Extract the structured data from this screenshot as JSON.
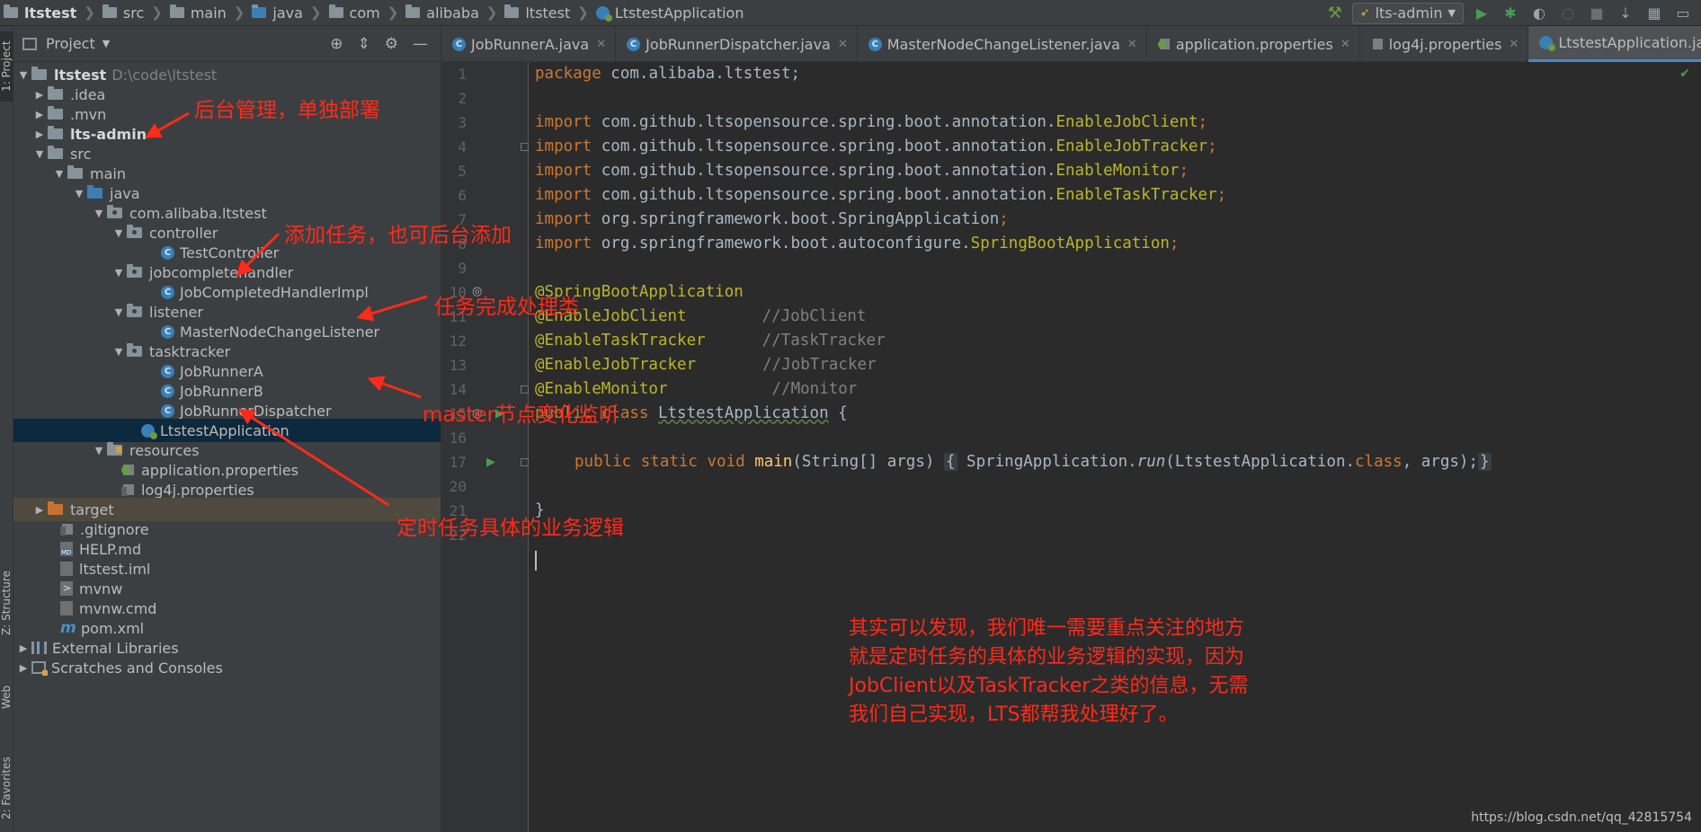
{
  "navbar": {
    "crumbs": [
      "ltstest",
      "src",
      "main",
      "java",
      "com",
      "alibaba",
      "ltstest",
      "LtstestApplication"
    ],
    "run_config": "lts-admin"
  },
  "left_stripe": {
    "project_tab": "1: Project",
    "structure_tab": "Z: Structure",
    "web_tab": "Web",
    "favorites_tab": "2: Favorites"
  },
  "project_panel": {
    "title": "Project",
    "tree": [
      {
        "label": "ltstest",
        "path": "D:\\code\\ltstest"
      },
      {
        "label": ".idea"
      },
      {
        "label": ".mvn"
      },
      {
        "label": "lts-admin"
      },
      {
        "label": "src"
      },
      {
        "label": "main"
      },
      {
        "label": "java"
      },
      {
        "label": "com.alibaba.ltstest"
      },
      {
        "label": "controller"
      },
      {
        "label": "TestController"
      },
      {
        "label": "jobcompletehandler"
      },
      {
        "label": "JobCompletedHandlerImpl"
      },
      {
        "label": "listener"
      },
      {
        "label": "MasterNodeChangeListener"
      },
      {
        "label": "tasktracker"
      },
      {
        "label": "JobRunnerA"
      },
      {
        "label": "JobRunnerB"
      },
      {
        "label": "JobRunnerDispatcher"
      },
      {
        "label": "LtstestApplication"
      },
      {
        "label": "resources"
      },
      {
        "label": "application.properties"
      },
      {
        "label": "log4j.properties"
      },
      {
        "label": "target"
      },
      {
        "label": ".gitignore"
      },
      {
        "label": "HELP.md"
      },
      {
        "label": "ltstest.iml"
      },
      {
        "label": "mvnw"
      },
      {
        "label": "mvnw.cmd"
      },
      {
        "label": "pom.xml"
      },
      {
        "label": "External Libraries"
      },
      {
        "label": "Scratches and Consoles"
      }
    ]
  },
  "editor": {
    "tabs": [
      {
        "label": "JobRunnerA.java"
      },
      {
        "label": "JobRunnerDispatcher.java"
      },
      {
        "label": "MasterNodeChangeListener.java"
      },
      {
        "label": "application.properties"
      },
      {
        "label": "log4j.properties"
      },
      {
        "label": "LtstestApplication.java"
      }
    ],
    "line_numbers": [
      "1",
      "2",
      "3",
      "4",
      "5",
      "6",
      "7",
      "8",
      "9",
      "10",
      "11",
      "12",
      "13",
      "14",
      "15",
      "16",
      "17",
      "20",
      "21",
      "22"
    ],
    "code": {
      "l1_kw": "package",
      "l1_rest": " com.alibaba.ltstest;",
      "import_kw": "import",
      "l3_pre": " com.github.ltsopensource.spring.boot.annotation.",
      "l3_cls": "EnableJobClient",
      "l4_cls": "EnableJobTracker",
      "l5_cls": "EnableMonitor",
      "l6_cls": "EnableTaskTracker",
      "l7_pre": " org.springframework.boot.",
      "l7_cls": "SpringApplication",
      "l8_pre": " org.springframework.boot.autoconfigure.",
      "l8_cls": "SpringBootApplication",
      "semi": ";",
      "l10": "@SpringBootApplication",
      "l11_ann": "@EnableJobClient",
      "l11_cm": "//JobClient",
      "l12_ann": "@EnableTaskTracker",
      "l12_cm": "//TaskTracker",
      "l13_ann": "@EnableJobTracker",
      "l13_cm": "//JobTracker",
      "l14_ann": "@EnableMonitor",
      "l14_cm": "//Monitor",
      "l15_kw": "public class",
      "l15_name": "LtstestApplication",
      "l15_rest": " {",
      "l17_kw": "public static void",
      "l17_fn": "main",
      "l17_sig": "(String[] args)",
      "l17_open": "{",
      "l17_body1": " SpringApplication.",
      "l17_run": "run",
      "l17_body2": "(LtstestApplication.",
      "l17_class": "class",
      "l17_body3": ", args);",
      "l17_close": "}",
      "l21": "}"
    }
  },
  "annotations": {
    "admin": "后台管理，单独部署",
    "controller": "添加任务，也可后台添加",
    "handler": "任务完成处理类",
    "listener": "master节点变化监听",
    "tasktracker": "定时任务具体的业务逻辑",
    "summary": [
      "其实可以发现，我们唯一需要重点关注的地方",
      "就是定时任务的具体的业务逻辑的实现，因为",
      "JobClient以及TaskTracker之类的信息，无需",
      "我们自己实现，LTS都帮我处理好了。"
    ]
  },
  "watermark": "https://blog.csdn.net/qq_42815754"
}
